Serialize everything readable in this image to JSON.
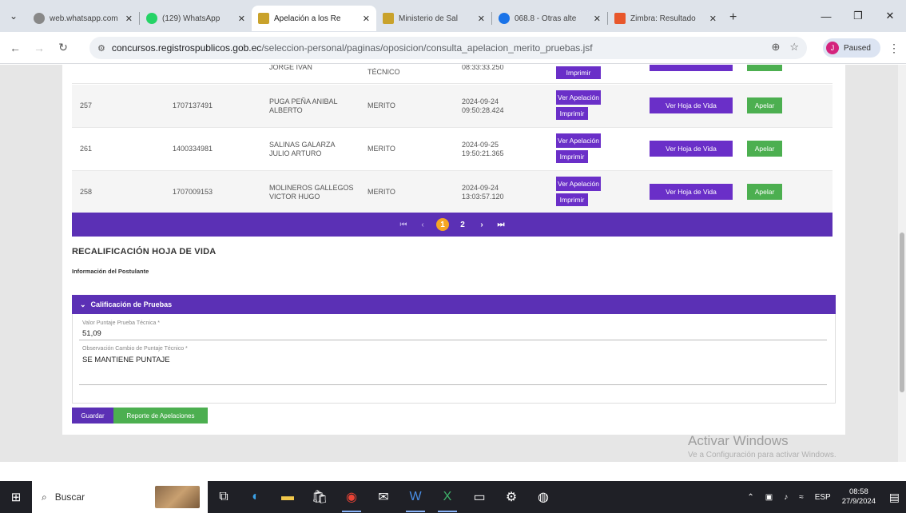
{
  "browser": {
    "tabs": [
      {
        "title": "web.whatsapp.com",
        "icon": "globe-icon",
        "color": "#888888"
      },
      {
        "title": "(129) WhatsApp",
        "icon": "whatsapp-icon",
        "color": "#25d366"
      },
      {
        "title": "Apelación a los Re",
        "icon": "ecuador-shield-icon",
        "color": "#c9a22b"
      },
      {
        "title": "Ministerio de Sal",
        "icon": "ecuador-shield-icon",
        "color": "#c9a22b"
      },
      {
        "title": "068.8 - Otras alte",
        "icon": "edge-icon",
        "color": "#1a73e8"
      },
      {
        "title": "Zimbra: Resultado",
        "icon": "zimbra-icon",
        "color": "#e8572b"
      }
    ],
    "new_tab": "+",
    "url_host": "concursos.registrospublicos.gob.ec",
    "url_path": "/seleccion-personal/paginas/oposicion/consulta_apelacion_merito_pruebas.jsf",
    "profile_label": "Paused",
    "profile_initial": "J"
  },
  "table": {
    "partial_row": {
      "name": "JORGE IVAN",
      "type": "TÉCNICO",
      "date": "08:33:33.250",
      "print_label": "Imprimir"
    },
    "rows": [
      {
        "id": "257",
        "cedula": "1707137491",
        "name": "PUGA PEÑA ANIBAL ALBERTO",
        "type": "MERITO",
        "date": "2024-09-24 09:50:28.424"
      },
      {
        "id": "261",
        "cedula": "1400334981",
        "name": "SALINAS GALARZA JULIO ARTURO",
        "type": "MERITO",
        "date": "2024-09-25 19:50:21.365"
      },
      {
        "id": "258",
        "cedula": "1707009153",
        "name": "MOLINEROS GALLEGOS VICTOR HUGO",
        "type": "MERITO",
        "date": "2024-09-24 13:03:57.120"
      }
    ],
    "labels": {
      "view_appeal": "Ver Apelación",
      "print": "Imprimir",
      "view_cv": "Ver Hoja de Vida",
      "appeal": "Apelar"
    },
    "paginator": {
      "first": "⏮",
      "prev": "‹",
      "pages": [
        "1",
        "2"
      ],
      "current": "1",
      "next": "›",
      "last": "⏭"
    }
  },
  "section": {
    "title": "RECALIFICACIÓN HOJA DE VIDA",
    "subtitle": "Información del Postulante",
    "panel_title": "Calificación de Pruebas",
    "field1_label": "Valor Puntaje Prueba Técnica *",
    "field1_value": "51,09",
    "field2_label": "Observación Cambio de Puntaje Técnico *",
    "field2_value": "SE MANTIENE PUNTAJE",
    "save_label": "Guardar",
    "report_label": "Reporte de Apelaciones"
  },
  "watermark": {
    "line1": "Activar Windows",
    "line2": "Ve a Configuración para activar Windows."
  },
  "taskbar": {
    "search_placeholder": "Buscar",
    "tray_lang": "ESP",
    "time": "08:58",
    "date": "27/9/2024"
  }
}
